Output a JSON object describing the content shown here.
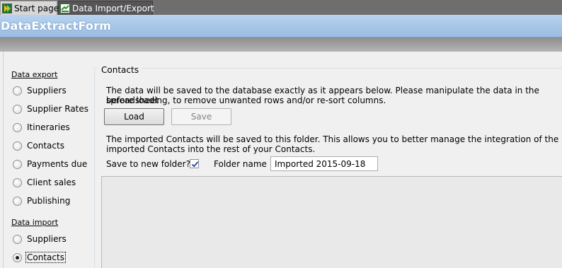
{
  "tabs": [
    {
      "label": "Start page",
      "icon": "start-page-icon",
      "active": false
    },
    {
      "label": "Data Import/Export",
      "icon": "data-import-export-icon",
      "active": true
    }
  ],
  "header": {
    "title": "DataExtractForm"
  },
  "sidebar": {
    "export_title": "Data export",
    "export_items": [
      "Suppliers",
      "Supplier Rates",
      "Itineraries",
      "Contacts",
      "Payments due",
      "Client sales",
      "Publishing"
    ],
    "import_title": "Data import",
    "import_items": [
      "Suppliers",
      "Contacts"
    ],
    "selected": "Data import / Contacts"
  },
  "main": {
    "group_title": "Contacts",
    "intro_line1": "The data will be saved to the database exactly as it appears below. Please manipulate the data in the spreadsheet",
    "intro_line2": "before loading, to remove unwanted rows and/or re-sort columns.",
    "load_label": "Load",
    "save_label": "Save",
    "folder_line1": "The imported Contacts will be saved to this folder. This allows you to better manage the integration of the",
    "folder_line2": "imported Contacts into the rest of your Contacts.",
    "save_to_new_folder_label": "Save to new folder?",
    "save_to_new_folder_checked": true,
    "folder_name_label": "Folder name",
    "folder_name_value": "Imported 2015-09-18"
  },
  "colors": {
    "header_blue": "#a9c8e8",
    "active_tab": "#565656",
    "grid_area": "#e9e9e9"
  }
}
